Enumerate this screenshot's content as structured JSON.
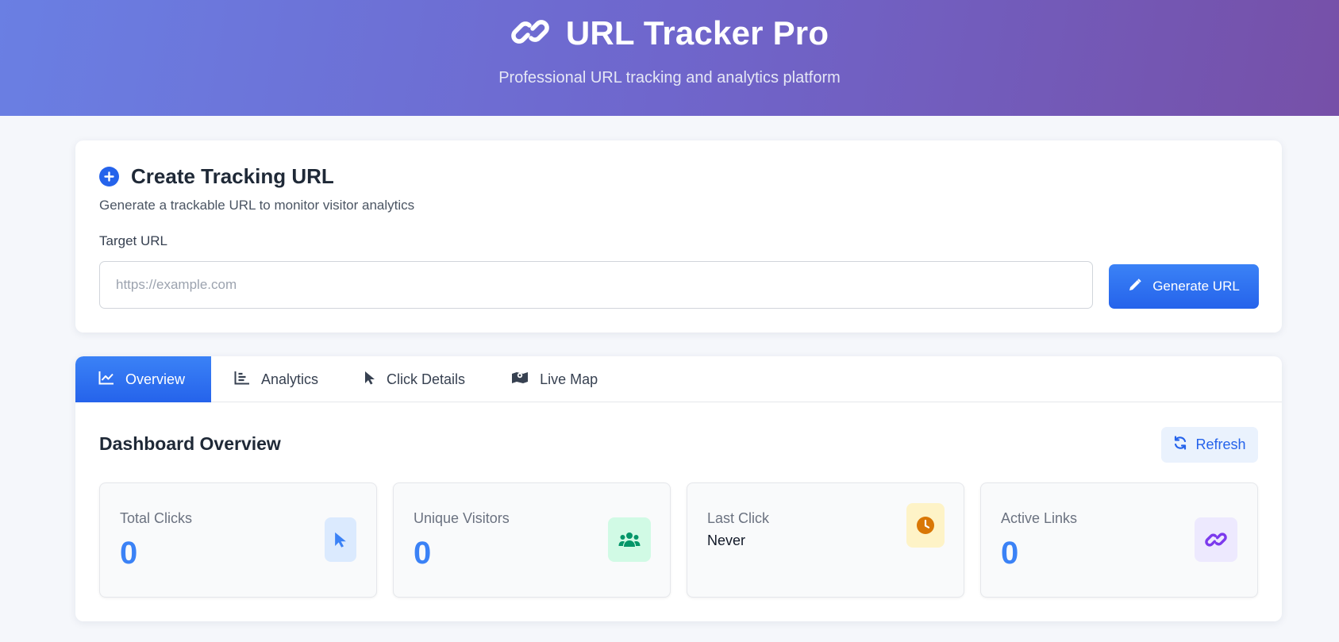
{
  "header": {
    "title": "URL Tracker Pro",
    "subtitle": "Professional URL tracking and analytics platform"
  },
  "create": {
    "title": "Create Tracking URL",
    "description": "Generate a trackable URL to monitor visitor analytics",
    "field_label": "Target URL",
    "placeholder": "https://example.com",
    "value": "",
    "button_label": "Generate URL"
  },
  "tabs": [
    {
      "label": "Overview",
      "icon": "chart-line-icon",
      "active": true
    },
    {
      "label": "Analytics",
      "icon": "bar-chart-icon",
      "active": false
    },
    {
      "label": "Click Details",
      "icon": "pointer-icon",
      "active": false
    },
    {
      "label": "Live Map",
      "icon": "map-icon",
      "active": false
    }
  ],
  "dashboard": {
    "title": "Dashboard Overview",
    "refresh_label": "Refresh",
    "stats": [
      {
        "label": "Total Clicks",
        "value": "0",
        "icon": "pointer-icon",
        "color": "#3b82f6",
        "bg": "#dbeafe"
      },
      {
        "label": "Unique Visitors",
        "value": "0",
        "icon": "users-icon",
        "color": "#059669",
        "bg": "#d1fae5"
      },
      {
        "label": "Last Click",
        "value": "Never",
        "icon": "clock-icon",
        "color": "#d97706",
        "bg": "#fef3c7"
      },
      {
        "label": "Active Links",
        "value": "0",
        "icon": "link-icon",
        "color": "#7c3aed",
        "bg": "#ede9fe"
      }
    ]
  },
  "colors": {
    "accent": "#2563eb",
    "header_gradient_start": "#6a7fe3",
    "header_gradient_end": "#7650a8"
  }
}
